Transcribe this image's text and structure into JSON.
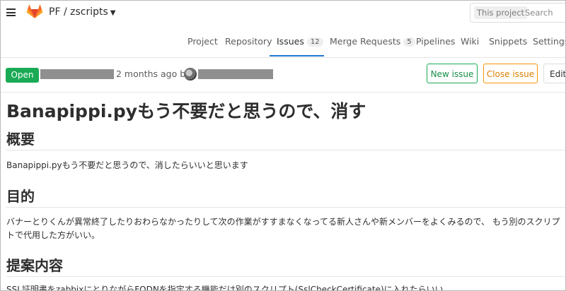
{
  "topbar": {
    "project": "PF / zscripts",
    "search": {
      "scope": "This project",
      "placeholder": "Search"
    }
  },
  "tabs": [
    {
      "label": "Project"
    },
    {
      "label": "Repository"
    },
    {
      "label": "Issues",
      "count": "12",
      "active": true
    },
    {
      "label": "Merge Requests",
      "count": "5"
    },
    {
      "label": "Pipelines"
    },
    {
      "label": "Wiki"
    },
    {
      "label": "Snippets"
    },
    {
      "label": "Settings"
    }
  ],
  "issue": {
    "status": "Open",
    "created": "2 months ago by",
    "buttons": {
      "new": "New issue",
      "close": "Close issue",
      "edit": "Edit"
    },
    "title": "Banapippi.pyもう不要だと思うので、消す",
    "sections": [
      {
        "heading": "概要",
        "body": "Banapippi.pyもう不要だと思うので、消したらいいと思います"
      },
      {
        "heading": "目的",
        "body": "バナーとりくんが異常終了したりおわらなかったりして次の作業がすすまなくなってる新人さんや新メンバーをよくみるので、 もう別のスクリプトで代用した方がいい。"
      },
      {
        "heading": "提案内容",
        "body": "SSL証明書をzabbixにとりながらFQDNを指定する機能だけ別のスクリプト(SslCheckCertificate)に入れたらいい"
      }
    ]
  },
  "colors": {
    "accent": "#1f78d1",
    "open": "#1aaa55",
    "warning": "#fc9403",
    "logo": "#e24329"
  }
}
